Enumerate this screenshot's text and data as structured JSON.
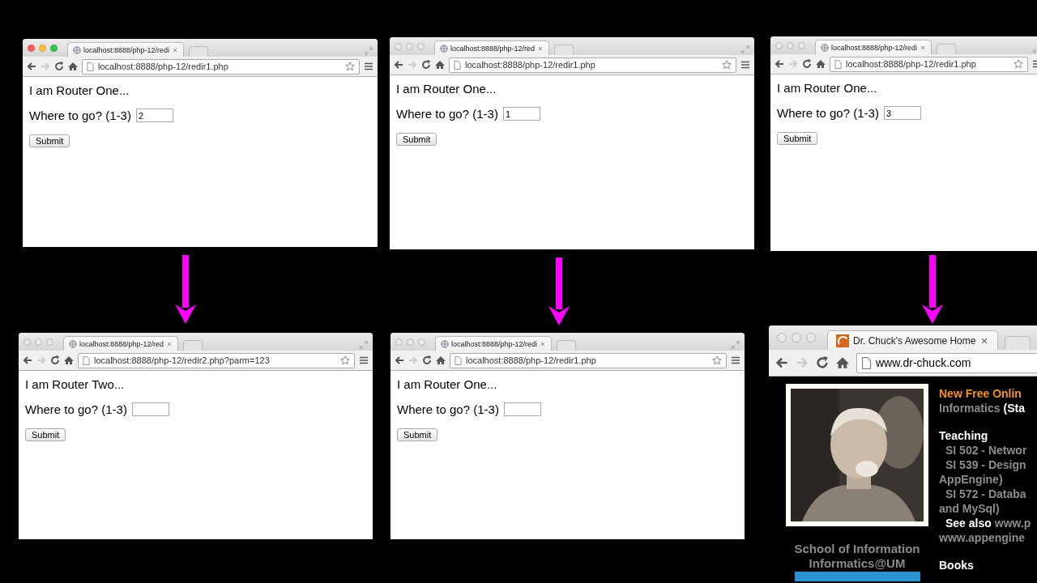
{
  "windows": [
    {
      "kind": "form",
      "focused": true,
      "tab_title": "localhost:8888/php-12/redi",
      "url": "localhost:8888/php-12/redir1.php",
      "heading": "I am Router One...",
      "prompt": "Where to go? (1-3)",
      "field": {
        "value": "2"
      },
      "button": "Submit"
    },
    {
      "kind": "form",
      "focused": false,
      "tab_title": "localhost:8888/php-12/red",
      "url": "localhost:8888/php-12/redir1.php",
      "heading": "I am Router One...",
      "prompt": "Where to go? (1-3)",
      "field": {
        "value": "1"
      },
      "button": "Submit"
    },
    {
      "kind": "form",
      "focused": false,
      "tab_title": "localhost:8888/php-12/redi",
      "url": "localhost:8888/php-12/redir1.php",
      "heading": "I am Router One...",
      "prompt": "Where to go? (1-3)",
      "field": {
        "value": "3"
      },
      "button": "Submit"
    },
    {
      "kind": "form",
      "focused": false,
      "tab_title": "localhost:8888/php-12/red",
      "url": "localhost:8888/php-12/redir2.php?parm=123",
      "heading": "I am Router Two...",
      "prompt": "Where to go? (1-3)",
      "button": "Submit"
    },
    {
      "kind": "form",
      "focused": false,
      "tab_title": "localhost:8888/php-12/redi",
      "url": "localhost:8888/php-12/redir1.php",
      "heading": "I am Router One...",
      "prompt": "Where to go? (1-3)",
      "button": "Submit"
    },
    {
      "kind": "homepage",
      "focused": false,
      "tab_title": "Dr. Chuck's Awesome Home",
      "url": "www.dr-chuck.com",
      "captions": [
        "School of Information",
        "Informatics@UM"
      ],
      "paragraphs": [
        [
          {
            "indent": false,
            "parts": [
              {
                "kind": "highlight",
                "text": "New Free Onlin"
              }
            ]
          },
          {
            "indent": false,
            "parts": [
              {
                "kind": "link",
                "text": "Informatics"
              },
              {
                "kind": "plain",
                "text": "(Sta"
              }
            ]
          }
        ],
        [
          {
            "indent": false,
            "parts": [
              {
                "kind": "plain",
                "text": "Teaching"
              }
            ]
          },
          {
            "indent": true,
            "parts": [
              {
                "kind": "link",
                "text": "SI 502 - Networ"
              }
            ]
          },
          {
            "indent": true,
            "parts": [
              {
                "kind": "link",
                "text": "SI 539 - Design"
              }
            ]
          },
          {
            "indent": false,
            "parts": [
              {
                "kind": "link",
                "text": "AppEngine)"
              }
            ]
          },
          {
            "indent": true,
            "parts": [
              {
                "kind": "link",
                "text": "SI 572 - Databa"
              }
            ]
          },
          {
            "indent": false,
            "parts": [
              {
                "kind": "link",
                "text": "and MySql)"
              }
            ]
          },
          {
            "indent": true,
            "parts": [
              {
                "kind": "plain",
                "text": "See also"
              },
              {
                "kind": "link",
                "text": "www.p"
              }
            ]
          },
          {
            "indent": false,
            "parts": [
              {
                "kind": "link",
                "text": "www.appengine"
              }
            ]
          }
        ],
        [
          {
            "indent": false,
            "parts": [
              {
                "kind": "plain",
                "text": "Books"
              }
            ]
          }
        ]
      ]
    }
  ]
}
